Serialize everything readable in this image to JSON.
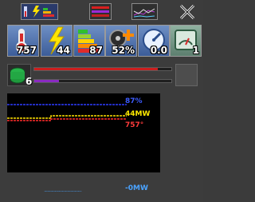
{
  "tiles": [
    {
      "icon": "thermometer-icon",
      "value": "757"
    },
    {
      "icon": "lightning-icon",
      "value": "44"
    },
    {
      "icon": "energy-rating-icon",
      "value": "87"
    },
    {
      "icon": "fan-plus-icon",
      "value": "52%"
    },
    {
      "icon": "speedometer-icon",
      "value": "0.0"
    },
    {
      "icon": "gauge-icon",
      "value": "1"
    }
  ],
  "generator": {
    "count": "6"
  },
  "bars": [
    {
      "color": "#cc1f1f",
      "fraction": 0.9
    },
    {
      "color": "#8a2ac2",
      "fraction": 0.18
    }
  ],
  "legend": [
    {
      "text": "87%",
      "color": "#3d5cff"
    },
    {
      "text": "44MW",
      "color": "#ffea00"
    },
    {
      "text": "757°",
      "color": "#ff3b3b"
    }
  ],
  "bottom_legend": {
    "text": "-0MW",
    "color": "#4aa3ff"
  },
  "colors": {
    "blue": "#2e3cff",
    "yellow": "#ffe100",
    "red": "#ff2b2b",
    "light_blue": "#4aa3ff"
  }
}
